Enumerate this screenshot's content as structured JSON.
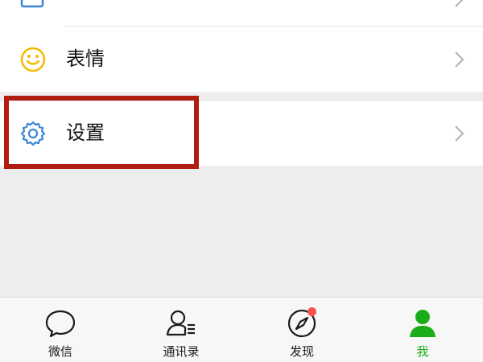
{
  "menu": {
    "wallet": {
      "icon": "wallet-icon"
    },
    "emoji": {
      "label": "表情",
      "icon": "emoji-icon"
    },
    "settings": {
      "label": "设置",
      "icon": "gear-icon"
    }
  },
  "tabbar": {
    "tabs": [
      {
        "label": "微信",
        "icon": "chat-bubble-icon",
        "active": false
      },
      {
        "label": "通讯录",
        "icon": "contacts-icon",
        "active": false
      },
      {
        "label": "发现",
        "icon": "compass-icon",
        "active": false,
        "badge": true
      },
      {
        "label": "我",
        "icon": "person-icon",
        "active": true
      }
    ]
  },
  "colors": {
    "accent": "#1aad19",
    "highlight": "#b01e12",
    "badge": "#fa5151",
    "emoji_icon": "#f5b900",
    "settings_icon": "#3a86d6"
  }
}
